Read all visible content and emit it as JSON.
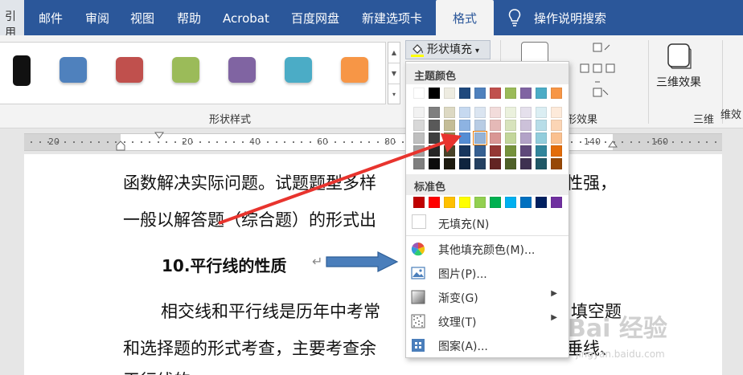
{
  "ribbon": {
    "left_stub": "引用",
    "tabs": [
      "邮件",
      "审阅",
      "视图",
      "帮助",
      "Acrobat",
      "百度网盘",
      "新建选项卡",
      "格式"
    ],
    "search": "操作说明搜索",
    "gallery_colors": [
      "#4f81bd",
      "#c0504d",
      "#9bbb59",
      "#8064a2",
      "#4bacc6",
      "#f79646"
    ],
    "shape_styles_label": "形状样式",
    "fill_button": "形状填充",
    "shape_effects_label": "形状效果",
    "effects_short": "形效果",
    "three_d_button": "三维效果",
    "three_d_group": "三维",
    "right_cut": "维效"
  },
  "ruler": {
    "numbers": [
      "20",
      "20",
      "40",
      "60",
      "80",
      "140",
      "160"
    ]
  },
  "document": {
    "line1": "函数解决实际问题。试题题型多样",
    "line1_end": "性强，",
    "line2": "一般以解答题（综合题）的形式出",
    "heading": "10.平行线的性质",
    "para_mark": "↵",
    "line3": "相交线和平行线是历年中考常",
    "line3_end": "填空题",
    "line4": "和选择题的形式考查，主要考查余",
    "line4_end": "垂线、",
    "line5": "平行线的"
  },
  "watermark": {
    "text": "Bai 经验",
    "url": "jingyan.baidu.com"
  },
  "dropdown": {
    "theme_header": "主题颜色",
    "theme_colors": [
      [
        "#ffffff",
        "#000000",
        "#eeece1",
        "#1f497d",
        "#4f81bd",
        "#c0504d",
        "#9bbb59",
        "#8064a2",
        "#4bacc6",
        "#f79646"
      ],
      [
        "#f2f2f2",
        "#7f7f7f",
        "#ddd9c3",
        "#c6d9f0",
        "#dbe5f1",
        "#f2dcdb",
        "#ebf1dd",
        "#e5e0ec",
        "#dbeef3",
        "#fdeada"
      ],
      [
        "#d8d8d8",
        "#595959",
        "#c4bd97",
        "#8db3e2",
        "#b8cce4",
        "#e5b9b7",
        "#d7e3bc",
        "#ccc1d9",
        "#b7dde8",
        "#fbd5b5"
      ],
      [
        "#bfbfbf",
        "#3f3f3f",
        "#938953",
        "#548dd4",
        "#95b3d7",
        "#d99694",
        "#c3d69b",
        "#b2a2c7",
        "#92cddc",
        "#fac08f"
      ],
      [
        "#a5a5a5",
        "#262626",
        "#494429",
        "#17365d",
        "#366092",
        "#953734",
        "#76923c",
        "#5f497a",
        "#31859b",
        "#e36c09"
      ],
      [
        "#7f7f7f",
        "#0c0c0c",
        "#1d1b10",
        "#0f243e",
        "#244061",
        "#632423",
        "#4f6128",
        "#3f3151",
        "#205867",
        "#974806"
      ]
    ],
    "selected": "row3-col4",
    "standard_header": "标准色",
    "standard_colors": [
      "#c00000",
      "#ff0000",
      "#ffc000",
      "#ffff00",
      "#92d050",
      "#00b050",
      "#00b0f0",
      "#0070c0",
      "#002060",
      "#7030a0"
    ],
    "items": [
      {
        "label": "无填充(N)",
        "submenu": false
      },
      {
        "label": "其他填充颜色(M)...",
        "submenu": false
      },
      {
        "label": "图片(P)...",
        "submenu": false
      },
      {
        "label": "渐变(G)",
        "submenu": true
      },
      {
        "label": "纹理(T)",
        "submenu": true
      },
      {
        "label": "图案(A)...",
        "submenu": false
      }
    ]
  }
}
